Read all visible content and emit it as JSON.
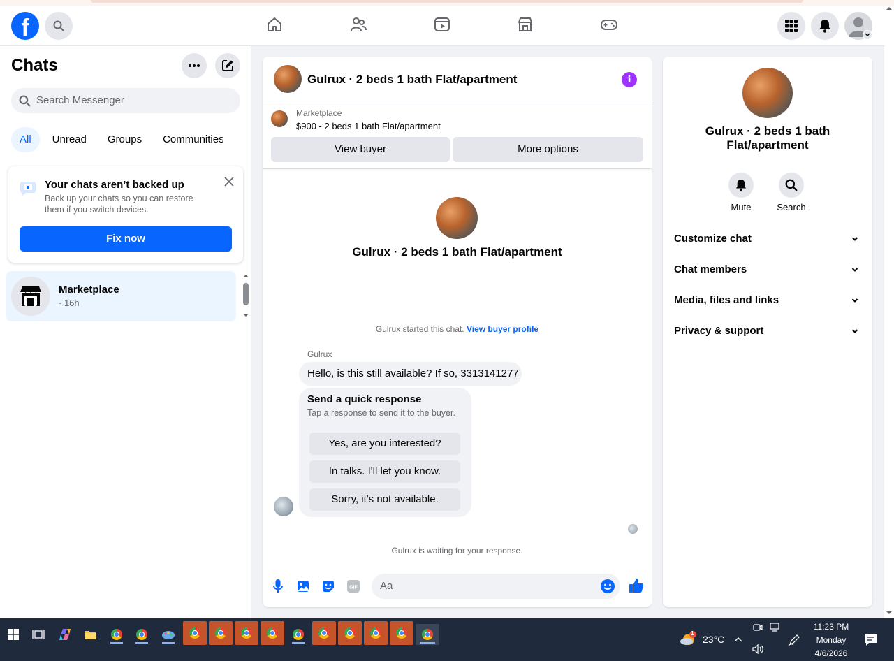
{
  "sidebar": {
    "title": "Chats",
    "search_placeholder": "Search Messenger",
    "filters": [
      "All",
      "Unread",
      "Groups",
      "Communities"
    ],
    "backup": {
      "title": "Your chats aren’t backed up",
      "text": "Back up your chats so you can restore them if you switch devices.",
      "button": "Fix now"
    },
    "chats": [
      {
        "name": "Marketplace",
        "time": "· 16h"
      }
    ]
  },
  "chat": {
    "title": "Gulrux · 2 beds 1 bath Flat/apartment",
    "marketplace_label": "Marketplace",
    "listing": "$900 - 2 beds 1 bath Flat/apartment",
    "view_buyer": "View buyer",
    "more_options": "More options",
    "intro_title": "Gulrux · 2 beds 1 bath Flat/apartment",
    "started_text": "Gulrux started this chat.",
    "view_buyer_profile": "View buyer profile",
    "sender": "Gulrux",
    "message": "Hello, is this still available? If so, 3313141277",
    "quick_response": {
      "title": "Send a quick response",
      "subtitle": "Tap a response to send it to the buyer.",
      "options": [
        "Yes, are you interested?",
        "In talks. I'll let you know.",
        "Sorry, it's not available."
      ]
    },
    "waiting": "Gulrux is waiting for your response.",
    "composer_placeholder": "Aa"
  },
  "info_panel": {
    "title": "Gulrux · 2 beds 1 bath Flat/apartment",
    "actions": [
      "Mute",
      "Search"
    ],
    "sections": [
      "Customize chat",
      "Chat members",
      "Media, files and links",
      "Privacy & support"
    ]
  },
  "taskbar": {
    "weather_temp": "23°C",
    "weather_badge": "1",
    "time": "11:23 PM",
    "day": "Monday",
    "date": "4/6/2026"
  },
  "colors": {
    "brand": "#0866ff",
    "info_icon": "#a033ff",
    "taskbar": "#1f2b3c"
  }
}
